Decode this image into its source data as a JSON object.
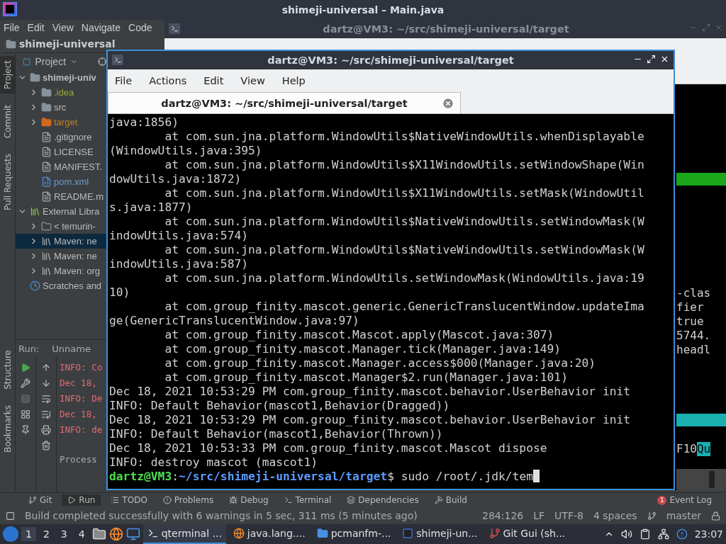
{
  "ide": {
    "title": "shimeji-universal – Main.java",
    "menu": [
      "File",
      "Edit",
      "View",
      "Navigate",
      "Code"
    ],
    "breadcrumb": "shimeji-universal",
    "side_tabs_top": [
      {
        "label": "Project",
        "selected": true
      },
      {
        "label": "Commit",
        "selected": false
      },
      {
        "label": "Pull Requests",
        "selected": false
      }
    ],
    "side_tabs_bottom": [
      {
        "label": "Structure",
        "selected": false
      },
      {
        "label": "Bookmarks",
        "selected": false
      }
    ],
    "project_panel": {
      "title": "Project",
      "tree": [
        {
          "label": "shimeji-univ",
          "kind": "module",
          "expanded": true,
          "selected": false,
          "children": [
            {
              "label": ".idea",
              "kind": "folder",
              "expanded": false,
              "selected": false,
              "color": "#9aa83a"
            },
            {
              "label": "src",
              "kind": "folder",
              "expanded": false,
              "selected": false,
              "color": "#bbbbbb"
            },
            {
              "label": "target",
              "kind": "excluded",
              "expanded": false,
              "selected": false,
              "color": "#b5822e"
            },
            {
              "label": ".gitignore",
              "kind": "file",
              "selected": false,
              "color": "#bbbbbb"
            },
            {
              "label": "LICENSE",
              "kind": "file",
              "selected": false,
              "color": "#bbbbbb"
            },
            {
              "label": "MANIFEST.",
              "kind": "file",
              "selected": false,
              "color": "#bbbbbb"
            },
            {
              "label": "pom.xml",
              "kind": "maven",
              "selected": false,
              "color": "#6a9fd0"
            },
            {
              "label": "README.m",
              "kind": "file",
              "selected": false,
              "color": "#bbbbbb"
            }
          ]
        },
        {
          "label": "External Libra",
          "kind": "libraries",
          "expanded": true,
          "selected": false,
          "children": [
            {
              "label": "< temurin-",
              "kind": "sdk",
              "expanded": false,
              "selected": false,
              "color": "#bbbbbb"
            },
            {
              "label": "Maven: ne",
              "kind": "library",
              "expanded": false,
              "selected": true,
              "color": "#bbbbbb"
            },
            {
              "label": "Maven: ne",
              "kind": "library",
              "expanded": false,
              "selected": false,
              "color": "#bbbbbb"
            },
            {
              "label": "Maven: org",
              "kind": "library",
              "expanded": false,
              "selected": false,
              "color": "#bbbbbb"
            }
          ]
        },
        {
          "label": "Scratches and",
          "kind": "scratch",
          "selected": false
        }
      ]
    },
    "run_panel": {
      "title": "Run:",
      "tab": "Unname",
      "output": [
        {
          "text": "INFO: Co",
          "kind": "error"
        },
        {
          "text": "Dec 18,",
          "kind": "error"
        },
        {
          "text": "INFO: De",
          "kind": "error"
        },
        {
          "text": "Dec 18,",
          "kind": "error"
        },
        {
          "text": "INFO: de",
          "kind": "error"
        },
        {
          "text": "Process",
          "kind": "plain"
        }
      ]
    },
    "tool_tabs": [
      {
        "label": "Git",
        "kind": "git",
        "selected": false
      },
      {
        "label": "Run",
        "kind": "run",
        "selected": true
      },
      {
        "label": "TODO",
        "kind": "todo",
        "selected": false
      },
      {
        "label": "Problems",
        "kind": "problems",
        "selected": false
      },
      {
        "label": "Debug",
        "kind": "debug",
        "selected": false
      },
      {
        "label": "Terminal",
        "kind": "terminal",
        "selected": false
      },
      {
        "label": "Dependencies",
        "kind": "dependencies",
        "selected": false
      },
      {
        "label": "Build",
        "kind": "build",
        "selected": false
      }
    ],
    "event_log": {
      "label": "Event Log",
      "badge": "1"
    },
    "status_bar": {
      "message": "Build completed successfully with 6 warnings in 5 sec, 311 ms (5 minutes ago)",
      "position": "284:126",
      "line_separator": "LF",
      "encoding": "UTF-8",
      "indent": "4 spaces",
      "branch": "master"
    }
  },
  "back_terminal": {
    "title": "dartz@VM3: ~/src/shimeji-universal/target",
    "highlight_bars": [
      {
        "color": "#1aa81a"
      },
      {
        "color": "#1ab0b0"
      }
    ],
    "lines": [
      "-clas",
      "fier",
      "true",
      "5744.",
      "headl"
    ],
    "key_hint": "F10",
    "key_label": "Qu"
  },
  "terminal": {
    "title": "dartz@VM3: ~/src/shimeji-universal/target",
    "menu": [
      "File",
      "Actions",
      "Edit",
      "View",
      "Help"
    ],
    "tab": "dartz@VM3: ~/src/shimeji-universal/target",
    "lines": [
      "java:1856)",
      "        at com.sun.jna.platform.WindowUtils$NativeWindowUtils.whenDisplayable",
      "(WindowUtils.java:395)",
      "        at com.sun.jna.platform.WindowUtils$X11WindowUtils.setWindowShape(Win",
      "dowUtils.java:1872)",
      "        at com.sun.jna.platform.WindowUtils$X11WindowUtils.setMask(WindowUtil",
      "s.java:1877)",
      "        at com.sun.jna.platform.WindowUtils$NativeWindowUtils.setWindowMask(W",
      "indowUtils.java:574)",
      "        at com.sun.jna.platform.WindowUtils$NativeWindowUtils.setWindowMask(W",
      "indowUtils.java:587)",
      "        at com.sun.jna.platform.WindowUtils.setWindowMask(WindowUtils.java:19",
      "10)",
      "        at com.group_finity.mascot.generic.GenericTranslucentWindow.updateIma",
      "ge(GenericTranslucentWindow.java:97)",
      "        at com.group_finity.mascot.Mascot.apply(Mascot.java:307)",
      "        at com.group_finity.mascot.Manager.tick(Manager.java:149)",
      "        at com.group_finity.mascot.Manager.access$000(Manager.java:20)",
      "        at com.group_finity.mascot.Manager$2.run(Manager.java:101)",
      "Dec 18, 2021 10:53:29 PM com.group_finity.mascot.behavior.UserBehavior init",
      "INFO: Default Behavior(mascot1,Behavior(Dragged))",
      "Dec 18, 2021 10:53:29 PM com.group_finity.mascot.behavior.UserBehavior init",
      "INFO: Default Behavior(mascot1,Behavior(Thrown))",
      "Dec 18, 2021 10:53:33 PM com.group_finity.mascot.Mascot dispose",
      "INFO: destroy mascot (mascot1)"
    ],
    "prompt": {
      "user": "dartz@VM3",
      "separator": ":",
      "path": "~/src/shimeji-universal/target",
      "symbol": "$",
      "command": "sudo /root/.jdk/tem"
    }
  },
  "taskbar": {
    "workspaces": [
      {
        "label": "1",
        "selected": true
      },
      {
        "label": "2",
        "selected": false
      },
      {
        "label": "3",
        "selected": false
      },
      {
        "label": "4",
        "selected": false
      }
    ],
    "tasks": [
      {
        "label": "qterminal ...",
        "kind": "terminal",
        "selected": true
      },
      {
        "label": "java.lang....",
        "kind": "browser",
        "selected": false
      },
      {
        "label": "pcmanfm-...",
        "kind": "folder",
        "selected": false
      },
      {
        "label": "shimeji-un...",
        "kind": "ide",
        "selected": false
      },
      {
        "label": "Git Gui (sh...",
        "kind": "git",
        "selected": false
      }
    ],
    "clock": "23:07"
  }
}
